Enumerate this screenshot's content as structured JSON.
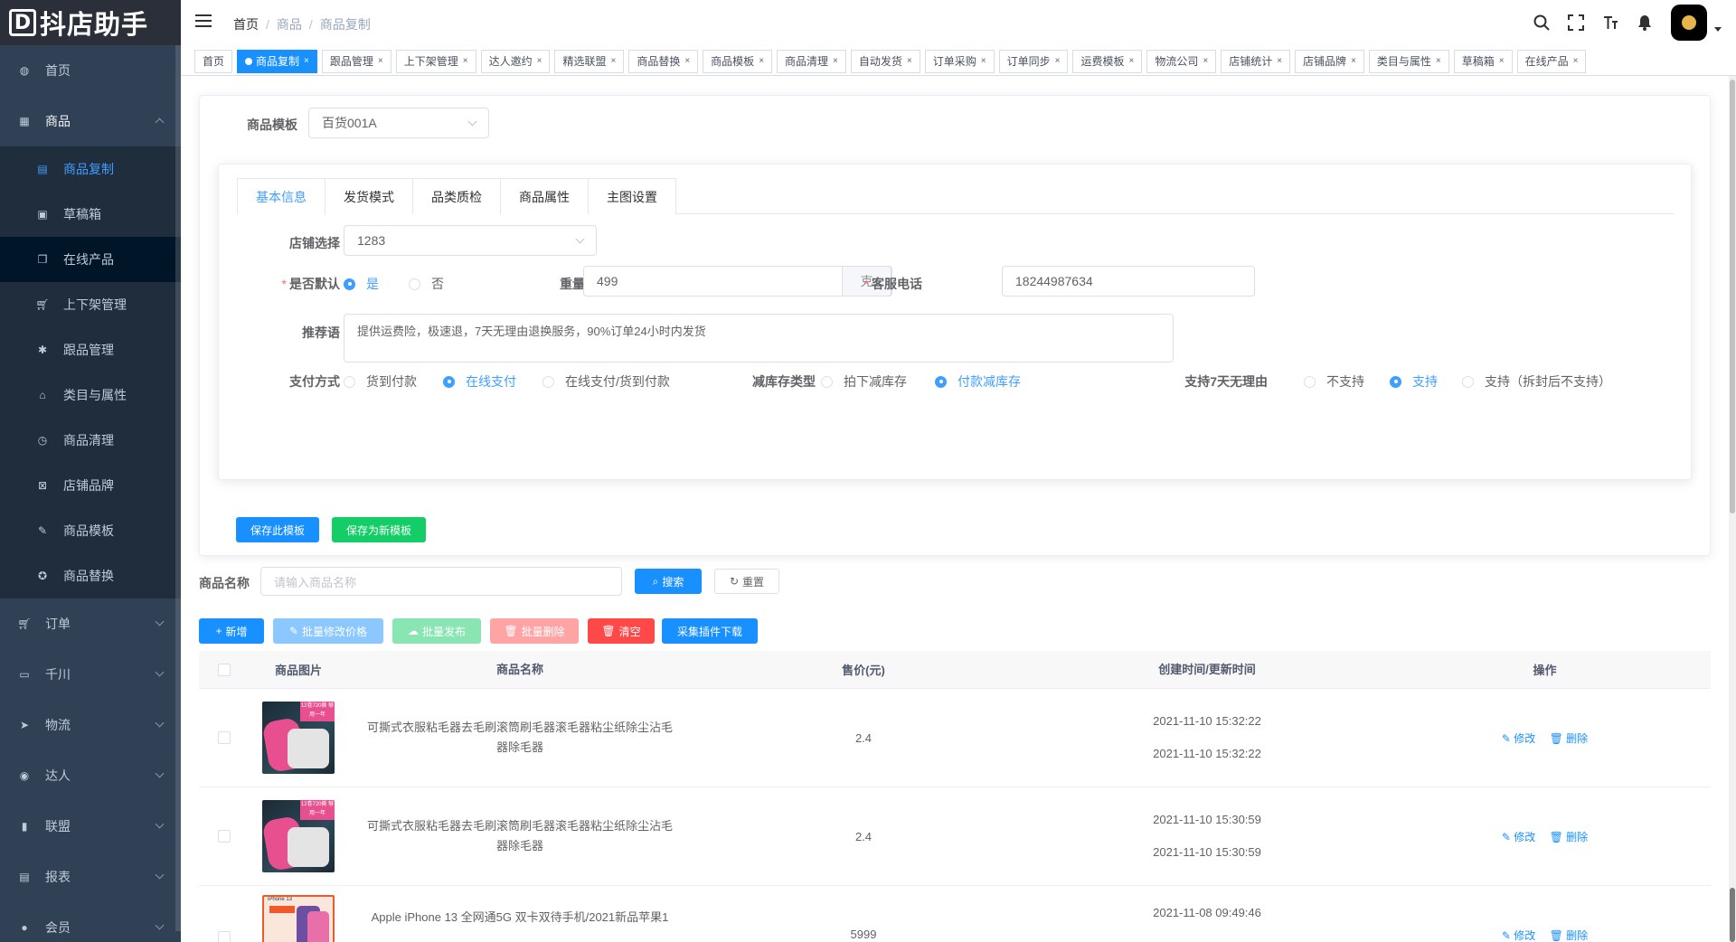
{
  "app": {
    "logo_mark": "D",
    "logo_text": "抖店助手"
  },
  "sidebar": {
    "items": [
      {
        "label": "首页",
        "icon": "dashboard-icon"
      },
      {
        "label": "商品",
        "icon": "grid-icon",
        "open": true
      },
      {
        "label": "订单",
        "icon": "cart-icon"
      },
      {
        "label": "千川",
        "icon": "monitor-icon"
      },
      {
        "label": "物流",
        "icon": "send-icon"
      },
      {
        "label": "达人",
        "icon": "globe-icon"
      },
      {
        "label": "联盟",
        "icon": "bar-chart-icon"
      },
      {
        "label": "报表",
        "icon": "report-icon"
      },
      {
        "label": "会员",
        "icon": "user-icon"
      }
    ],
    "sub_items": [
      {
        "label": "商品复制",
        "active": true
      },
      {
        "label": "草稿箱"
      },
      {
        "label": "在线产品"
      },
      {
        "label": "上下架管理"
      },
      {
        "label": "跟品管理"
      },
      {
        "label": "类目与属性"
      },
      {
        "label": "商品清理"
      },
      {
        "label": "店铺品牌"
      },
      {
        "label": "商品模板"
      },
      {
        "label": "商品替换"
      }
    ]
  },
  "breadcrumb": [
    "首页",
    "商品",
    "商品复制"
  ],
  "tags": [
    "首页",
    "商品复制",
    "跟品管理",
    "上下架管理",
    "达人邀约",
    "精选联盟",
    "商品替换",
    "商品模板",
    "商品清理",
    "自动发货",
    "订单采购",
    "订单同步",
    "运费模板",
    "物流公司",
    "店铺统计",
    "店铺品牌",
    "类目与属性",
    "草稿箱",
    "在线产品"
  ],
  "template": {
    "label": "商品模板",
    "value": "百货001A",
    "tabs": [
      "基本信息",
      "发货模式",
      "品类质检",
      "商品属性",
      "主图设置"
    ],
    "shop_label": "店铺选择",
    "shop_value": "1283",
    "default_label": "是否默认",
    "default_yes": "是",
    "default_no": "否",
    "weight_label": "重量",
    "weight_value": "499",
    "weight_unit": "克",
    "phone_label": "客服电话",
    "phone_value": "18244987634",
    "recommend_label": "推荐语",
    "recommend_value": "提供运费险，极速退，7天无理由退换服务，90%订单24小时内发货",
    "pay_label": "支付方式",
    "pay_options": [
      "货到付款",
      "在线支付",
      "在线支付/货到付款"
    ],
    "stock_label": "减库存类型",
    "stock_options": [
      "拍下减库存",
      "付款减库存"
    ],
    "return_label": "支持7天无理由",
    "return_options": [
      "不支持",
      "支持",
      "支持（拆封后不支持）"
    ],
    "save_btn": "保存此模板",
    "save_new_btn": "保存为新模板"
  },
  "search": {
    "label": "商品名称",
    "placeholder": "请输入商品名称",
    "search_btn": "搜索",
    "reset_btn": "重置"
  },
  "toolbar": {
    "add": "新增",
    "batch_price": "批量修改价格",
    "batch_publish": "批量发布",
    "batch_delete": "批量删除",
    "clear": "清空",
    "plugin": "采集插件下载"
  },
  "table": {
    "headers": [
      "商品图片",
      "商品名称",
      "售价(元)",
      "创建时间/更新时间",
      "操作"
    ],
    "edit": "修改",
    "delete": "删除",
    "rows": [
      {
        "name": "可撕式衣服粘毛器去毛刷滚筒刷毛器滚毛器粘尘纸除尘沾毛器除毛器",
        "price": "2.4",
        "created": "2021-11-10 15:32:22",
        "updated": "2021-11-10 15:32:22",
        "img_badge": "12卷720撕 够用一年"
      },
      {
        "name": "可撕式衣服粘毛器去毛刷滚筒刷毛器滚毛器粘尘纸除尘沾毛器除毛器",
        "price": "2.4",
        "created": "2021-11-10 15:30:59",
        "updated": "2021-11-10 15:30:59",
        "img_badge": "12卷720撕 够用一年"
      },
      {
        "name": "Apple iPhone 13 全网通5G 双卡双待手机/2021新品苹果1",
        "price": "5999",
        "created": "2021-11-08 09:49:46",
        "updated": "",
        "img_badge": "iPhone 13"
      }
    ]
  },
  "colors": {
    "primary": "#1890ff",
    "sidebar_bg": "#304156",
    "success": "#13ce66",
    "danger": "#ff4949"
  }
}
